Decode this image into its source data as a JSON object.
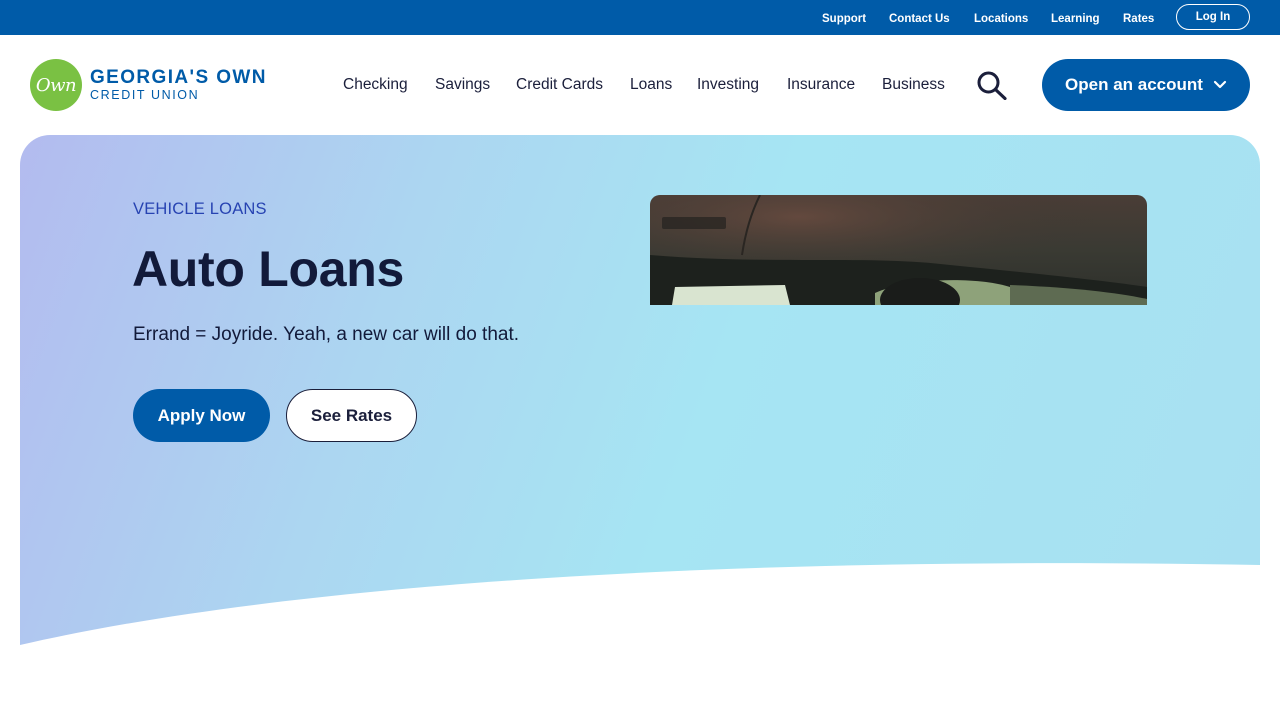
{
  "utility": {
    "links": [
      "Support",
      "Contact Us",
      "Locations",
      "Learning",
      "Rates"
    ],
    "login_label": "Log In"
  },
  "logo": {
    "badge": "Own",
    "line1": "GEORGIA'S OWN",
    "line2": "CREDIT UNION"
  },
  "nav": {
    "items": [
      "Checking",
      "Savings",
      "Credit Cards",
      "Loans",
      "Investing",
      "Insurance",
      "Business"
    ],
    "search_icon": "search-icon",
    "open_account_label": "Open an account"
  },
  "hero": {
    "eyebrow": "VEHICLE LOANS",
    "title": "Auto Loans",
    "tagline": "Errand = Joyride. Yeah, a new car will do that.",
    "apply_label": "Apply Now",
    "rates_label": "See Rates"
  },
  "colors": {
    "brand_blue": "#005ba8",
    "logo_green": "#7ac143",
    "eyebrow_blue": "#2743b2",
    "text_dark": "#121a3a"
  }
}
